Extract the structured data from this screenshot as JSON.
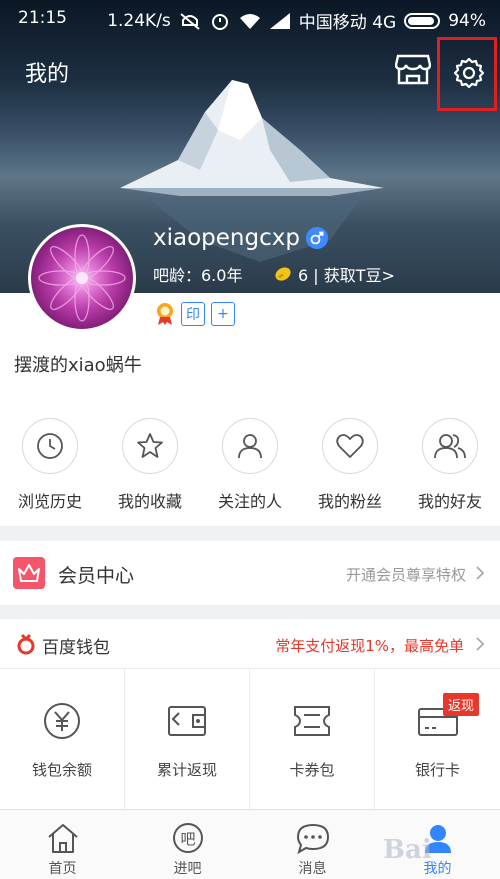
{
  "statusbar": {
    "time": "21:15",
    "speed": "1.24K/s",
    "carrier": "中国移动 4G",
    "battery": "94%"
  },
  "header": {
    "title": "我的"
  },
  "user": {
    "name": "xiaopengcxp",
    "age": "吧龄：6.0年",
    "beans": "6 | 获取T豆>",
    "tag_seal": "印",
    "tag_add": "+",
    "motto": "摆渡的xiao蜗牛"
  },
  "quick_actions": [
    {
      "label": "浏览历史",
      "icon": "clock-icon"
    },
    {
      "label": "我的收藏",
      "icon": "star-icon"
    },
    {
      "label": "关注的人",
      "icon": "person-icon"
    },
    {
      "label": "我的粉丝",
      "icon": "heart-icon"
    },
    {
      "label": "我的好友",
      "icon": "friends-icon"
    }
  ],
  "member": {
    "title": "会员中心",
    "hint": "开通会员尊享特权"
  },
  "wallet": {
    "title": "百度钱包",
    "promo": "常年支付返现1%，最高免单",
    "items": [
      {
        "label": "钱包余额",
        "icon": "yuan-icon"
      },
      {
        "label": "累计返现",
        "icon": "wallet-icon"
      },
      {
        "label": "卡券包",
        "icon": "ticket-icon"
      },
      {
        "label": "银行卡",
        "icon": "bank-card-icon",
        "badge": "返现"
      }
    ]
  },
  "tabs": [
    {
      "label": "首页",
      "icon": "home-icon"
    },
    {
      "label": "进吧",
      "icon": "ba-icon"
    },
    {
      "label": "消息",
      "icon": "message-icon"
    },
    {
      "label": "我的",
      "icon": "profile-icon",
      "active": true
    }
  ],
  "watermark": "Bai"
}
